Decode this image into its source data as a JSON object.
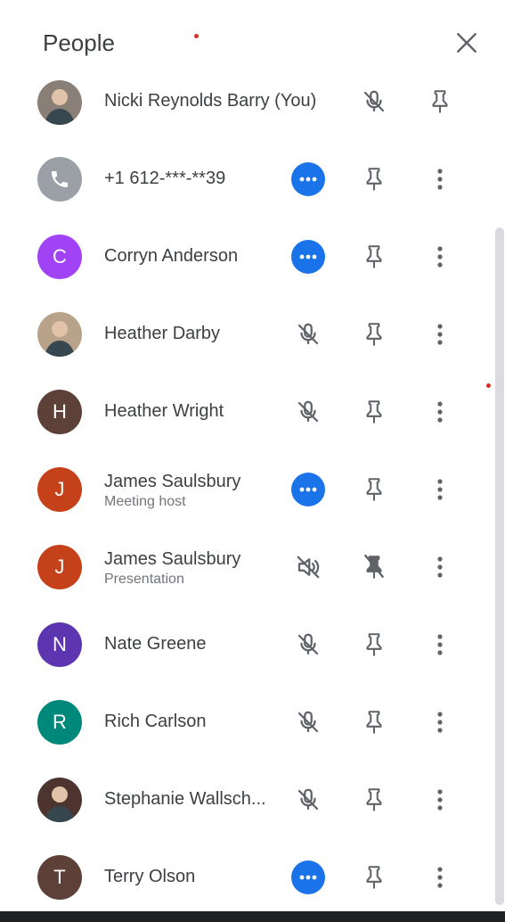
{
  "header": {
    "title": "People",
    "close_icon": "close-icon"
  },
  "participants": [
    {
      "name": "Nicki Reynolds Barry (You)",
      "sub": "",
      "avatar": "photo",
      "avatar_letter": "",
      "avatar_color": "#8a7f76",
      "audio": "muted",
      "pin": "pin",
      "more": false
    },
    {
      "name": "+1 612-***-**39",
      "sub": "",
      "avatar": "phone",
      "avatar_letter": "",
      "avatar_color": "#9aa0a6",
      "audio": "speaking",
      "pin": "pin",
      "more": true
    },
    {
      "name": "Corryn Anderson",
      "sub": "",
      "avatar": "letter",
      "avatar_letter": "C",
      "avatar_color": "#a142f4",
      "audio": "speaking",
      "pin": "pin",
      "more": true
    },
    {
      "name": "Heather Darby",
      "sub": "",
      "avatar": "photo",
      "avatar_letter": "",
      "avatar_color": "#b9a28a",
      "audio": "muted",
      "pin": "pin",
      "more": true
    },
    {
      "name": "Heather Wright",
      "sub": "",
      "avatar": "letter",
      "avatar_letter": "H",
      "avatar_color": "#5d4037",
      "audio": "muted",
      "pin": "pin",
      "more": true
    },
    {
      "name": "James Saulsbury",
      "sub": "Meeting host",
      "avatar": "letter",
      "avatar_letter": "J",
      "avatar_color": "#c5411a",
      "audio": "speaking",
      "pin": "pin",
      "more": true
    },
    {
      "name": "James Saulsbury",
      "sub": "Presentation",
      "avatar": "letter",
      "avatar_letter": "J",
      "avatar_color": "#c5411a",
      "audio": "volume-off",
      "pin": "pin-off",
      "more": true
    },
    {
      "name": "Nate Greene",
      "sub": "",
      "avatar": "letter",
      "avatar_letter": "N",
      "avatar_color": "#5e35b1",
      "audio": "muted",
      "pin": "pin",
      "more": true
    },
    {
      "name": "Rich Carlson",
      "sub": "",
      "avatar": "letter",
      "avatar_letter": "R",
      "avatar_color": "#00897b",
      "audio": "muted",
      "pin": "pin",
      "more": true
    },
    {
      "name": "Stephanie Wallsch...",
      "sub": "",
      "avatar": "photo",
      "avatar_letter": "",
      "avatar_color": "#4e342e",
      "audio": "muted",
      "pin": "pin",
      "more": true
    },
    {
      "name": "Terry Olson",
      "sub": "",
      "avatar": "letter",
      "avatar_letter": "T",
      "avatar_color": "#5d4037",
      "audio": "speaking",
      "pin": "pin",
      "more": true
    }
  ]
}
